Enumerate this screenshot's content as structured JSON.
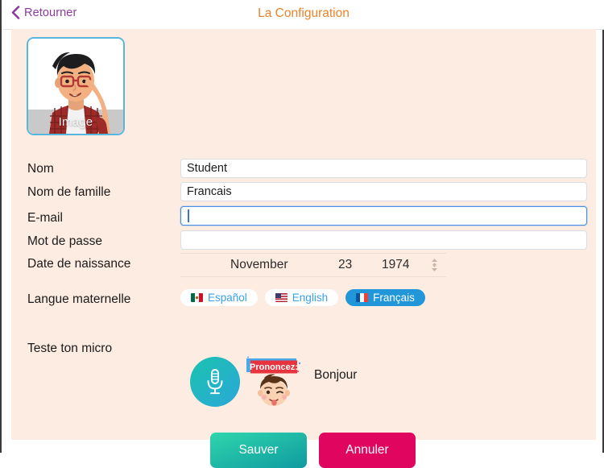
{
  "navbar": {
    "back_label": "Retourner",
    "title": "La Configuration",
    "back_icon": "chevron-left-icon",
    "back_color": "#8e3a9e",
    "title_color": "#e8842a"
  },
  "avatar": {
    "caption": "Image",
    "border_color": "#55b6e0",
    "description": "cartoon-young-man-with-glasses-and-red-plaid-shirt"
  },
  "form": {
    "fields": [
      {
        "label": "Nom",
        "value": "Student",
        "placeholder": "",
        "focused": false
      },
      {
        "label": "Nom de famille",
        "value": "Francais",
        "placeholder": "",
        "focused": false
      },
      {
        "label": "E-mail",
        "value": "",
        "placeholder": "",
        "focused": true
      },
      {
        "label": "Mot de passe",
        "value": "",
        "placeholder": "",
        "focused": false
      }
    ],
    "birthdate": {
      "label": "Date de naissance",
      "month": "November",
      "day": "23",
      "year": "1974",
      "stepper_icon": "up-down-stepper-icon"
    },
    "language": {
      "label": "Langue maternelle",
      "options": [
        {
          "name": "Español",
          "flag": "mexico-flag-icon",
          "selected": false
        },
        {
          "name": "English",
          "flag": "usa-flag-icon",
          "selected": false
        },
        {
          "name": "Français",
          "flag": "france-flag-icon",
          "selected": true
        }
      ],
      "selected_color": "#2196d8",
      "unselected_text_color": "#3aa0e8"
    },
    "mic_test": {
      "label": "Teste ton micro",
      "mic_icon": "microphone-icon",
      "badge_text": "Prononcez:",
      "face_icon": "winking-boy-face-icon",
      "word": "Bonjour"
    }
  },
  "actions": {
    "save_label": "Sauver",
    "cancel_label": "Annuler",
    "save_color": "#18b9a6",
    "cancel_color": "#e0065f"
  },
  "theme": {
    "background": "#fdece2",
    "page_background": "#ffffff"
  }
}
